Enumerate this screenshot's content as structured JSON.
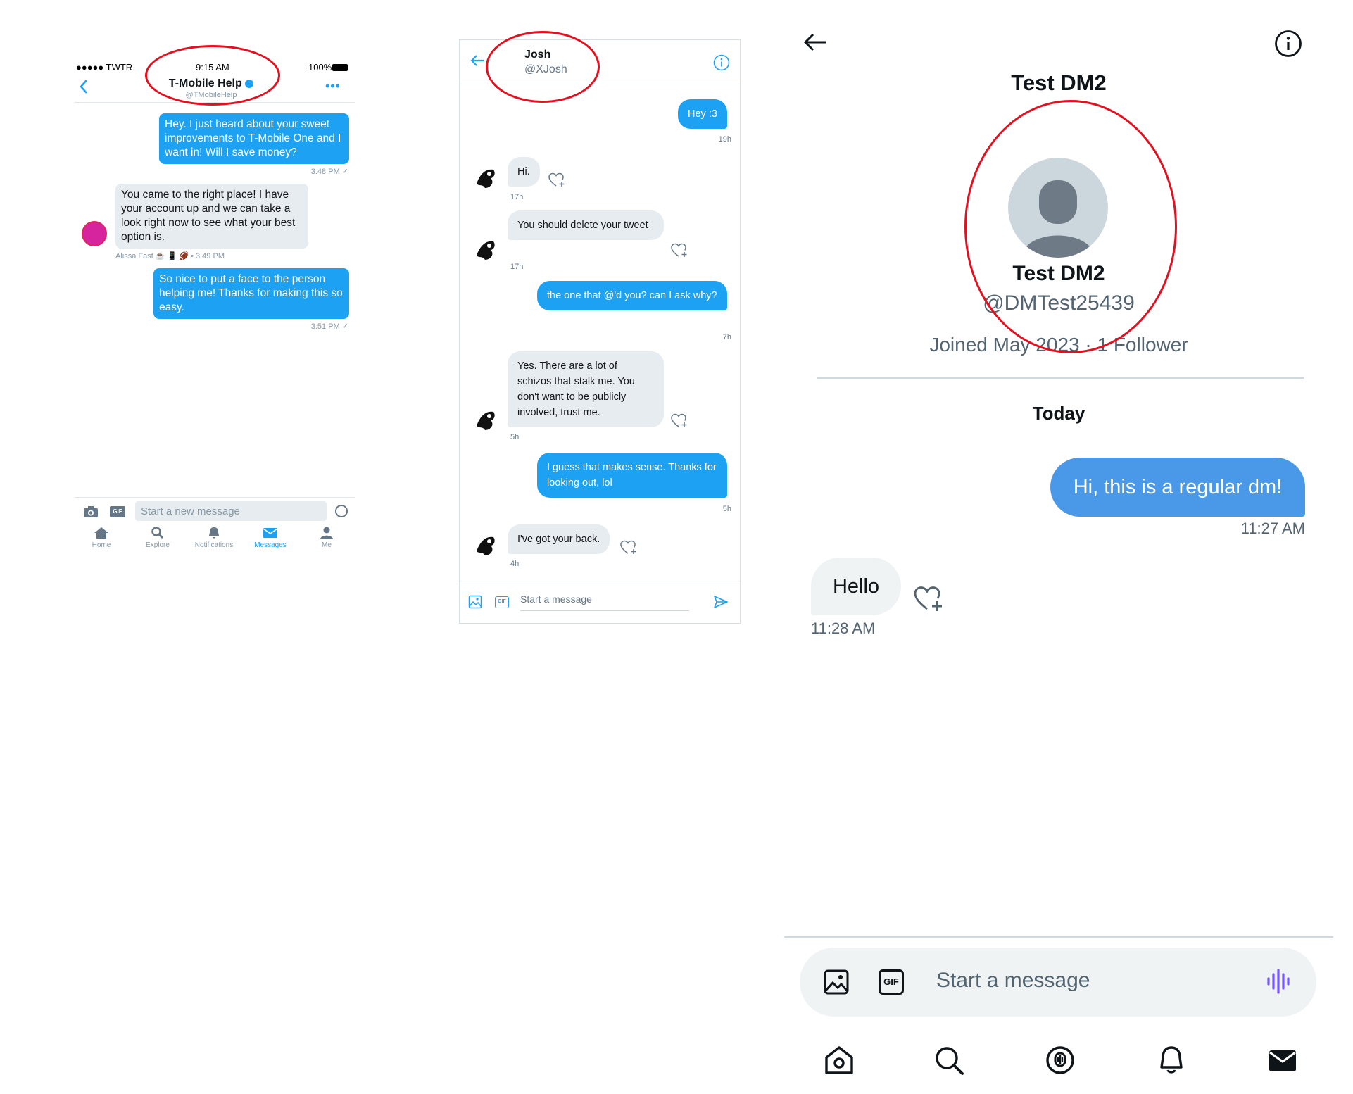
{
  "panel1": {
    "status": {
      "carrier": "●●●●● TWTR",
      "time": "9:15 AM",
      "battery": "100%"
    },
    "header": {
      "name": "T-Mobile Help",
      "handle": "@TMobileHelp"
    },
    "messages": [
      {
        "text": "Hey. I just heard about your sweet improvements to T-Mobile One and I want in! Will I save money?",
        "meta": "3:48 PM ✓"
      },
      {
        "text": "You came to the right place! I have your account up and we can take a look right now to see what your best option is.",
        "meta": "Alissa Fast ☕ 📱 🏈 • 3:49 PM"
      },
      {
        "text": "So nice to put a face to the person helping me! Thanks for making this so easy.",
        "meta": "3:51 PM ✓"
      }
    ],
    "composer": {
      "placeholder": "Start a new message",
      "gif": "GIF"
    },
    "tabs": [
      "Home",
      "Explore",
      "Notifications",
      "Messages",
      "Me"
    ]
  },
  "panel2": {
    "header": {
      "name": "Josh",
      "handle": "@XJosh"
    },
    "messages": [
      {
        "text": "Hey :3",
        "time": "19h"
      },
      {
        "text": "Hi.",
        "time": "17h"
      },
      {
        "text": "You should delete your tweet",
        "time": "17h"
      },
      {
        "text": "the one that @'d you? can I ask why?",
        "time": "7h"
      },
      {
        "text": "Yes. There are a lot of schizos that stalk me. You don't want to be publicly involved, trust me.",
        "time": "5h"
      },
      {
        "text": "I guess that makes sense. Thanks for looking out, lol",
        "time": "5h"
      },
      {
        "text": "I've got your back.",
        "time": "4h"
      }
    ],
    "composer": {
      "placeholder": "Start a message",
      "gif": "GIF"
    }
  },
  "panel3": {
    "title": "Test DM2",
    "profile": {
      "name": "Test DM2",
      "handle": "@DMTest25439",
      "meta": "Joined May 2023 · 1 Follower"
    },
    "day_label": "Today",
    "messages": [
      {
        "text": "Hi, this is a regular dm!",
        "time": "11:27 AM"
      },
      {
        "text": "Hello",
        "time": "11:28 AM"
      }
    ],
    "composer": {
      "placeholder": "Start a message",
      "gif": "GIF"
    }
  },
  "colors": {
    "twitter_blue": "#1da1f2",
    "x_blue": "#4a99e9",
    "annotation_red": "#e3101f",
    "voice_purple": "#7856ff"
  }
}
